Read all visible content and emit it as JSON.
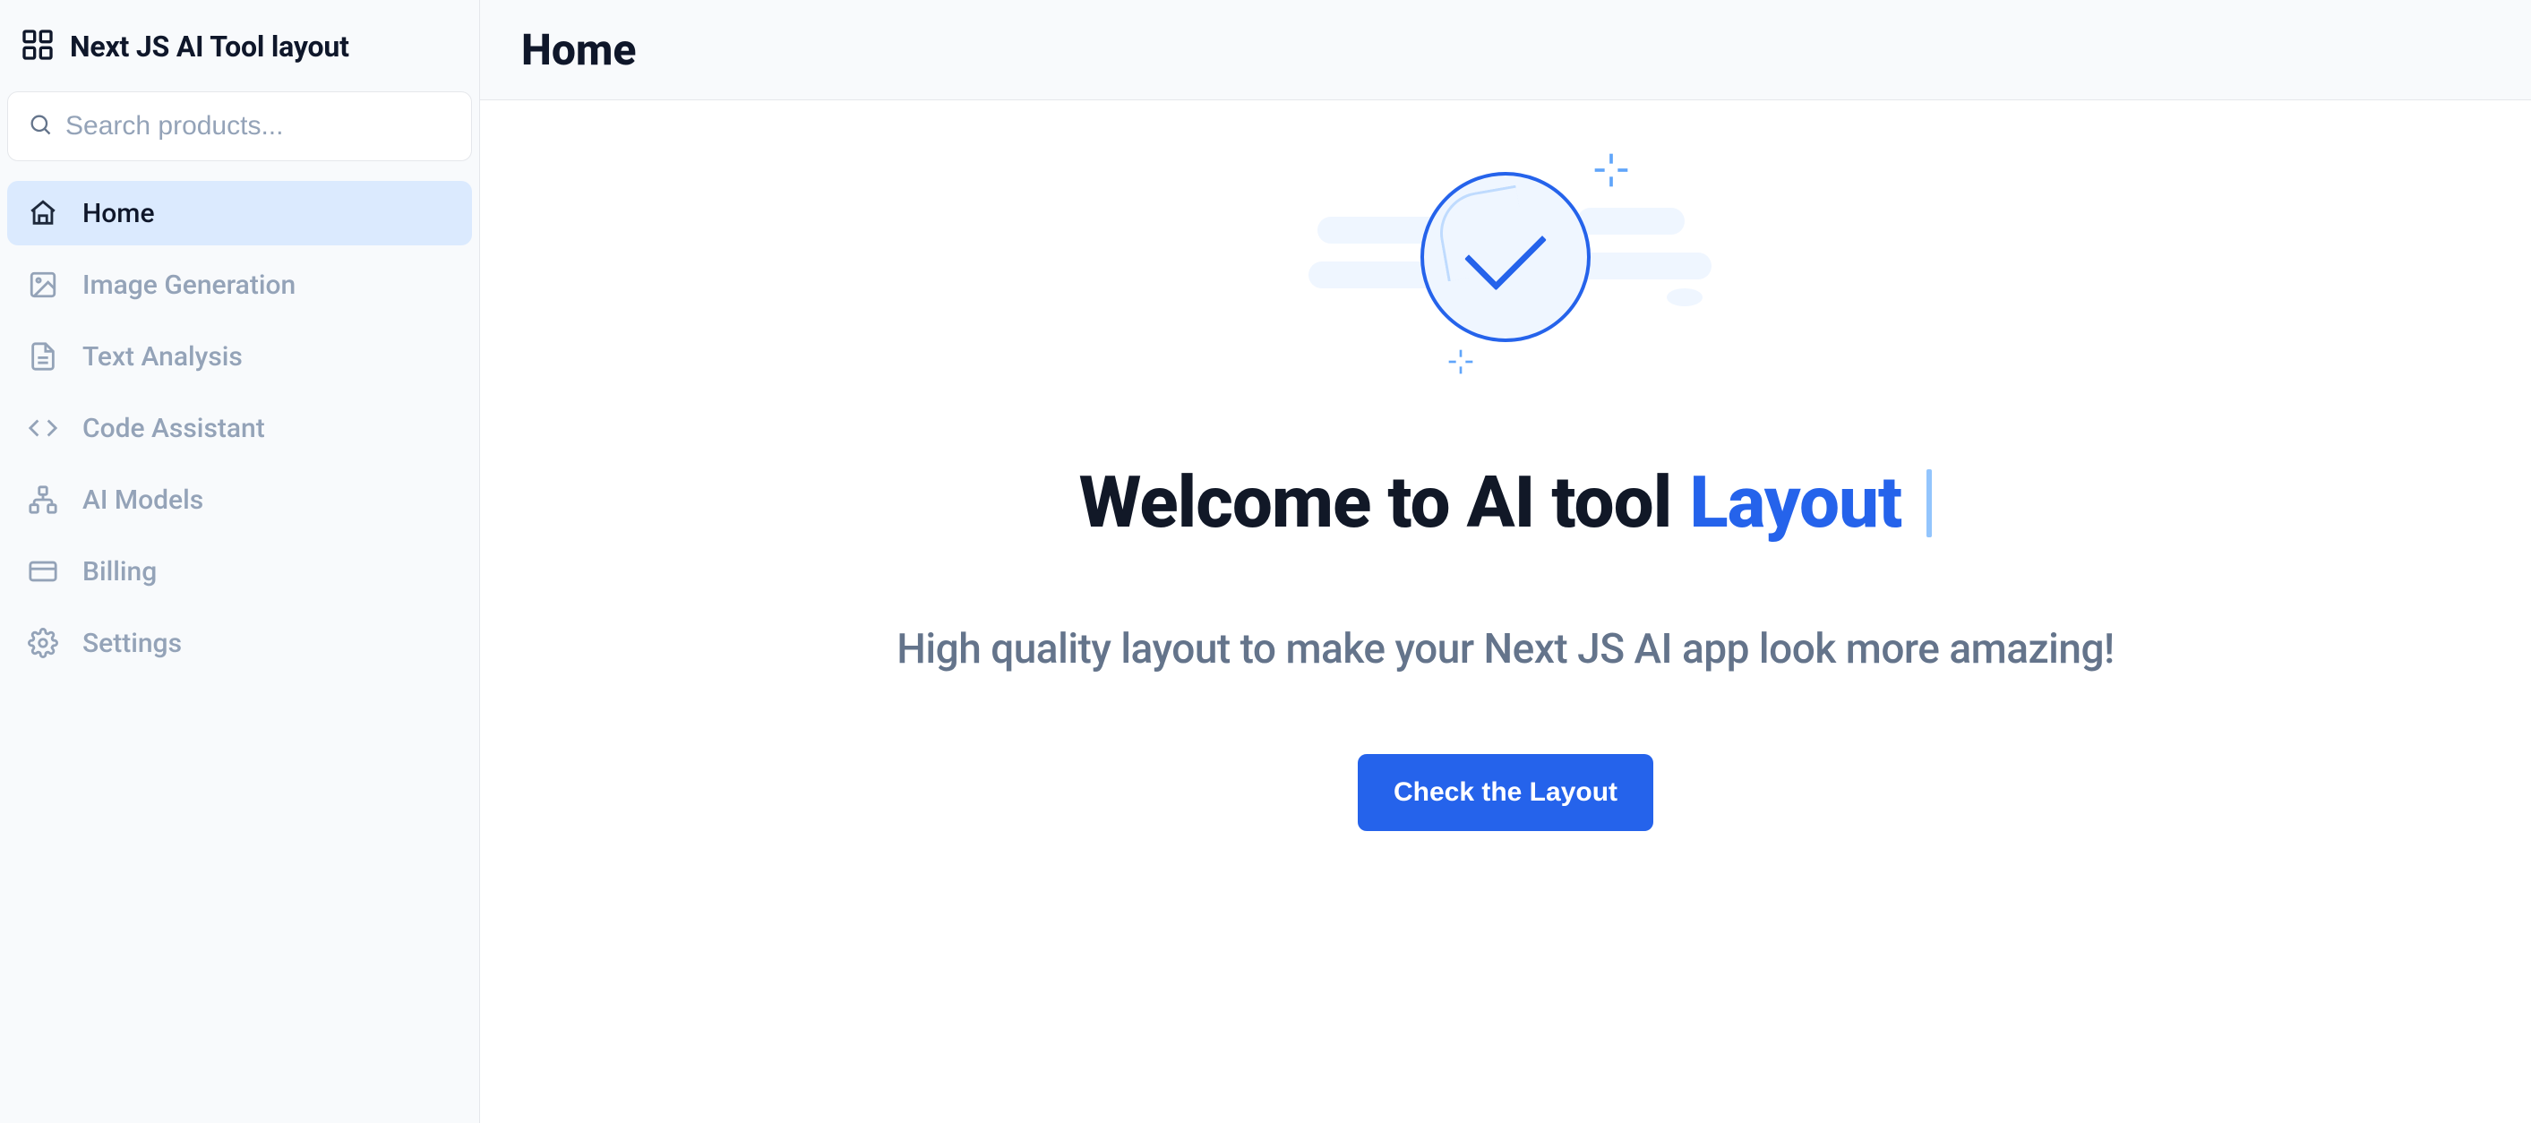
{
  "brand": {
    "title": "Next JS AI Tool layout"
  },
  "search": {
    "placeholder": "Search products..."
  },
  "nav": {
    "items": [
      {
        "label": "Home",
        "active": true,
        "icon": "home-icon"
      },
      {
        "label": "Image Generation",
        "active": false,
        "icon": "image-icon"
      },
      {
        "label": "Text Analysis",
        "active": false,
        "icon": "file-text-icon"
      },
      {
        "label": "Code Assistant",
        "active": false,
        "icon": "code-icon"
      },
      {
        "label": "AI Models",
        "active": false,
        "icon": "network-icon"
      },
      {
        "label": "Billing",
        "active": false,
        "icon": "credit-card-icon"
      },
      {
        "label": "Settings",
        "active": false,
        "icon": "gear-icon"
      }
    ]
  },
  "header": {
    "title": "Home"
  },
  "hero": {
    "headline_prefix": "Welcome to AI tool",
    "headline_accent": "Layout",
    "subhead": "High quality layout to make your Next JS AI app look more amazing!",
    "cta_label": "Check the Layout"
  }
}
